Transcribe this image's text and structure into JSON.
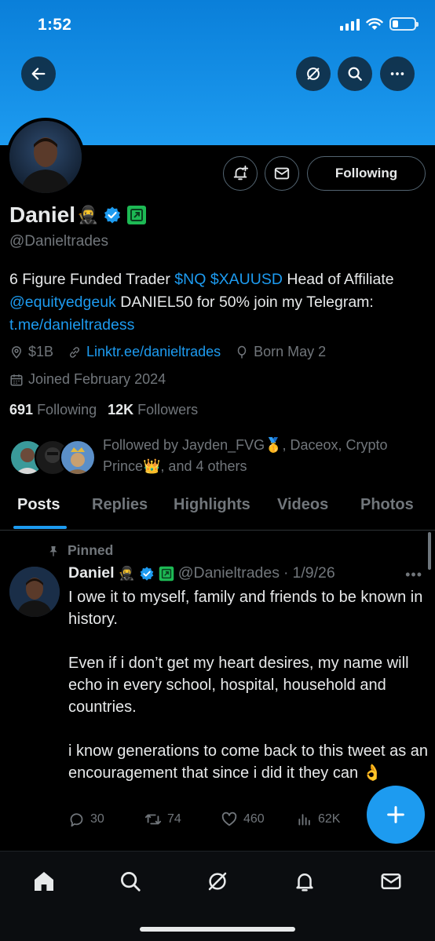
{
  "status_bar": {
    "time": "1:52",
    "battery_level": 0.25
  },
  "header": {
    "icons": [
      "back-arrow-icon",
      "grok-icon",
      "search-icon",
      "more-icon"
    ]
  },
  "profile": {
    "follow_button_label": "Following",
    "name": "Daniel",
    "name_emoji": "🥷",
    "handle": "@Danieltrades",
    "bio": {
      "part1": "6 Figure Funded Trader ",
      "cashtag1": "$NQ",
      "space1": " ",
      "cashtag2": "$XAUUSD",
      "part2": " Head of Affiliate ",
      "mention": "@equityedgeuk",
      "part3": " DANIEL50 for 50% join my Telegram: ",
      "link": "t.me/danieltradess"
    },
    "location": "$1B",
    "website": "Linktr.ee/danieltrades",
    "birthday": "Born May 2",
    "joined": "Joined February 2024",
    "following_count": "691",
    "following_label": "Following",
    "followers_count": "12K",
    "followers_label": "Followers",
    "followed_by": "Followed by Jayden_FVG🥇, Daceox, Crypto Prince👑, and 4 others"
  },
  "tabs": [
    {
      "label": "Posts",
      "active": true
    },
    {
      "label": "Replies"
    },
    {
      "label": "Highlights"
    },
    {
      "label": "Videos"
    },
    {
      "label": "Photos"
    }
  ],
  "post": {
    "pinned_label": "Pinned",
    "author_name": "Daniel",
    "author_emoji": "🥷",
    "author_handle": "@Danieltrades",
    "separator": "·",
    "date": "1/9/26",
    "text": "I owe it to myself, family and friends to be known in history.\n\nEven if i don’t get my heart desires, my name will echo in every school, hospital, household and countries.\n\ni know generations to come back to this tweet as an encouragement that since i did it they can 👌",
    "replies": "30",
    "reposts": "74",
    "likes": "460",
    "views": "62K"
  },
  "bottom_nav": [
    "home-icon",
    "search-icon",
    "grok-icon",
    "notifications-icon",
    "messages-icon"
  ],
  "colors": {
    "accent": "#1d9bf0",
    "background": "#000000",
    "muted": "#71767b",
    "text": "#e7e9ea",
    "badge_green": "#1db954"
  }
}
